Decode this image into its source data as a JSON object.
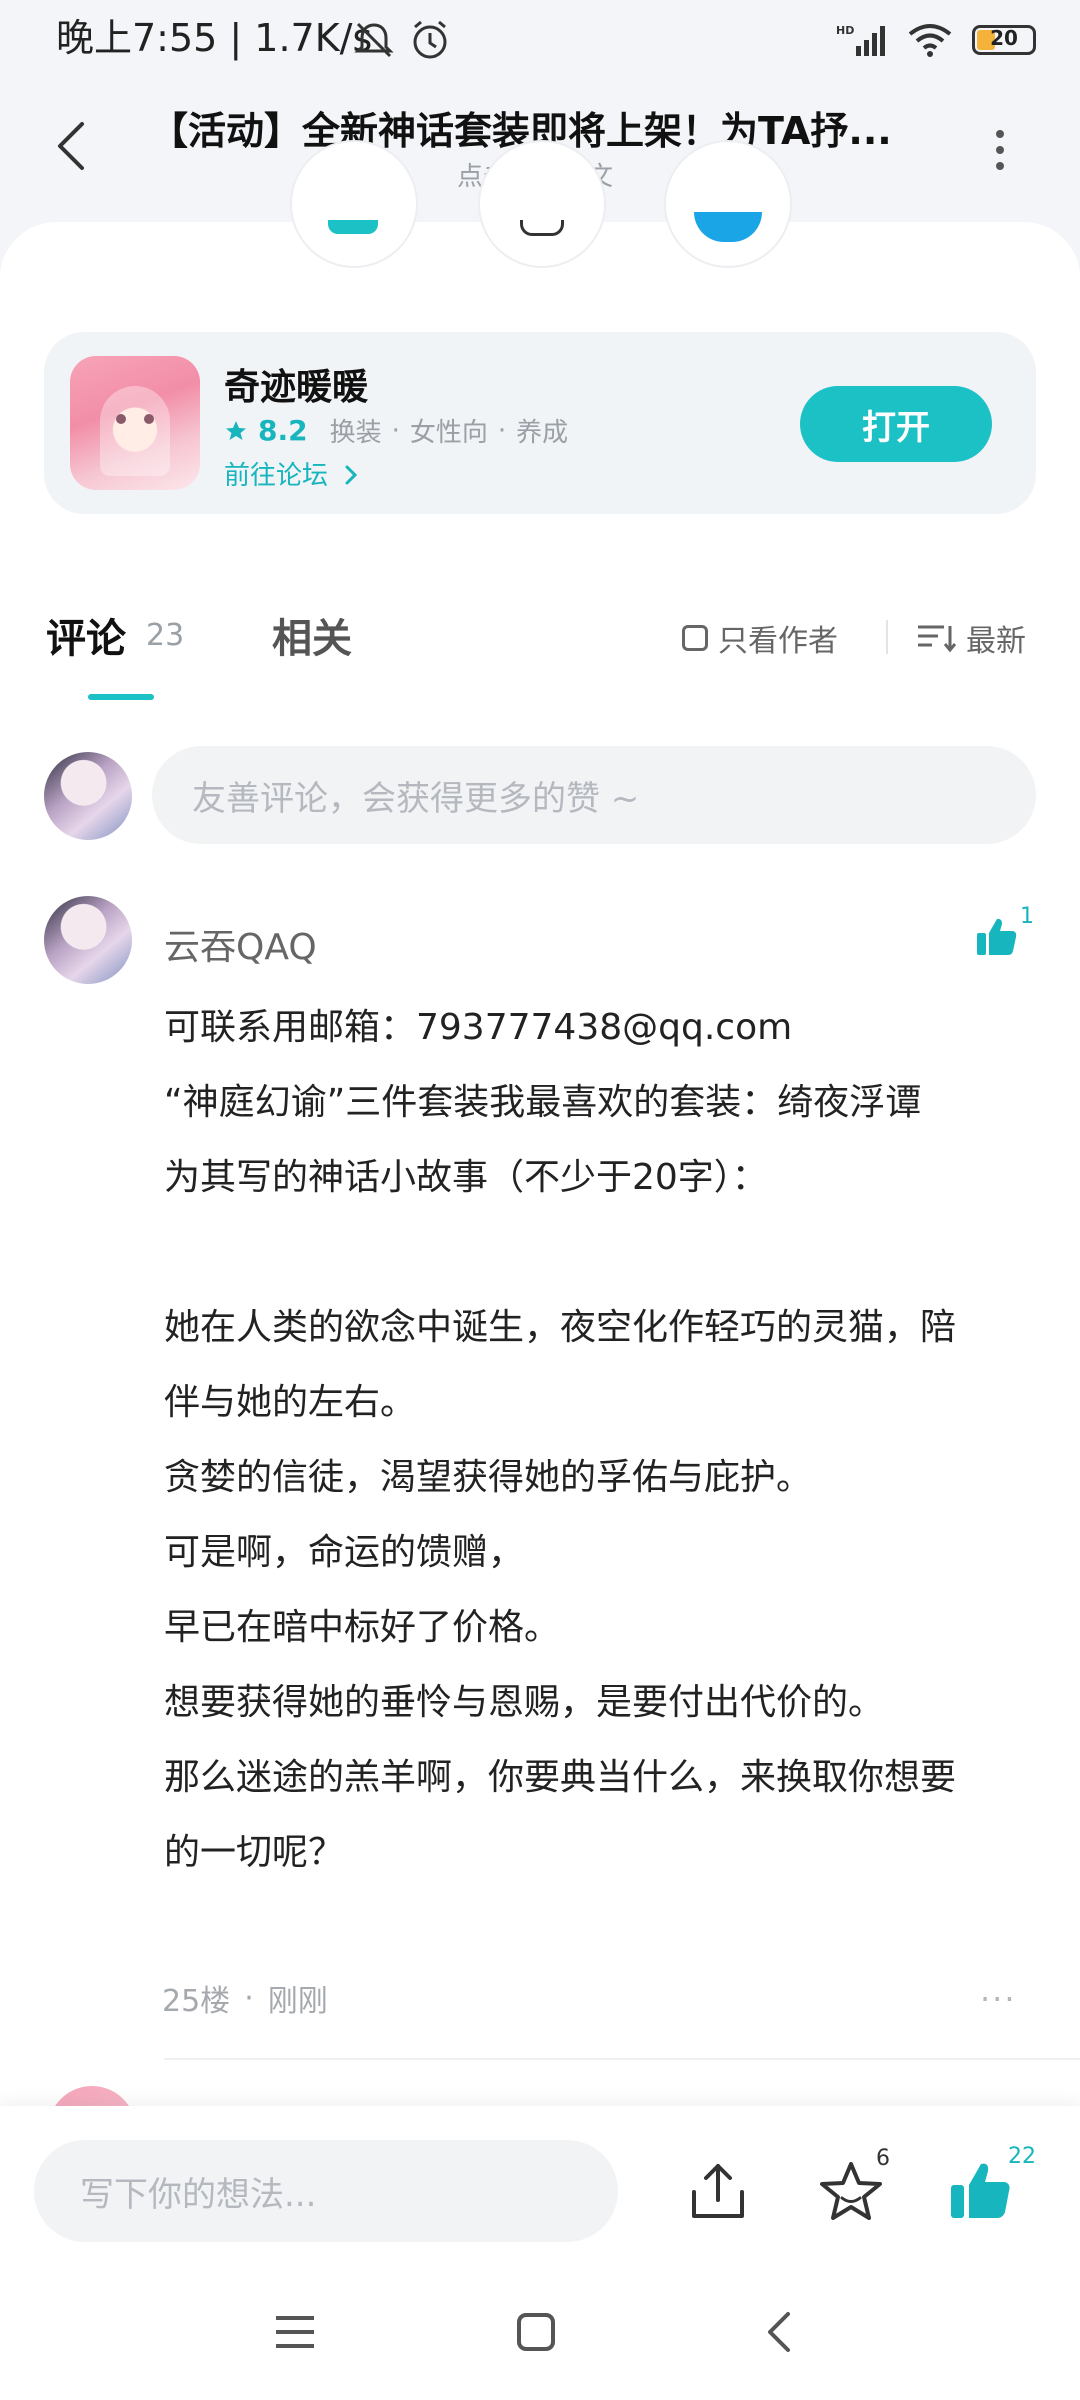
{
  "status_bar": {
    "time": "晚上7:55 | 1.7K/s",
    "battery": "20"
  },
  "header": {
    "title": "【活动】全新神话套装即将上架！为TA抒...",
    "subtitle": "点击查看原文"
  },
  "app_card": {
    "name": "奇迹暖暖",
    "score": "8.2",
    "tags": [
      "换装",
      "女性向",
      "养成"
    ],
    "forum_link": "前往论坛",
    "open_button": "打开"
  },
  "tabs": {
    "comments_label": "评论",
    "comments_count": "23",
    "related_label": "相关",
    "only_author": "只看作者",
    "sort": "最新"
  },
  "comment_input": {
    "placeholder": "友善评论，会获得更多的赞 ~"
  },
  "comment": {
    "username": "云吞QAQ",
    "likes": "1",
    "lines": [
      "可联系用邮箱：793777438@qq.com",
      "“神庭幻谕”三件套装我最喜欢的套装：绮夜浮谭",
      "为其写的神话小故事（不少于20字）：",
      "",
      "她在人类的欲念中诞生，夜空化作轻巧的灵猫，陪",
      "伴与她的左右。",
      "贪婪的信徒，渴望获得她的孚佑与庇护。",
      "可是啊，命运的馈赠，",
      "早已在暗中标好了价格。",
      "想要获得她的垂怜与恩赐，是要付出代价的。",
      "那么迷途的羔羊啊，你要典当什么，来换取你想要",
      "的一切呢？"
    ],
    "floor": "25楼",
    "time": "刚刚",
    "more": "···"
  },
  "bottom_bar": {
    "placeholder": "写下你的想法...",
    "favorites_count": "6",
    "likes_count": "22"
  },
  "colors": {
    "accent": "#1cc1c6",
    "header_bg": "#f3f5f8"
  }
}
